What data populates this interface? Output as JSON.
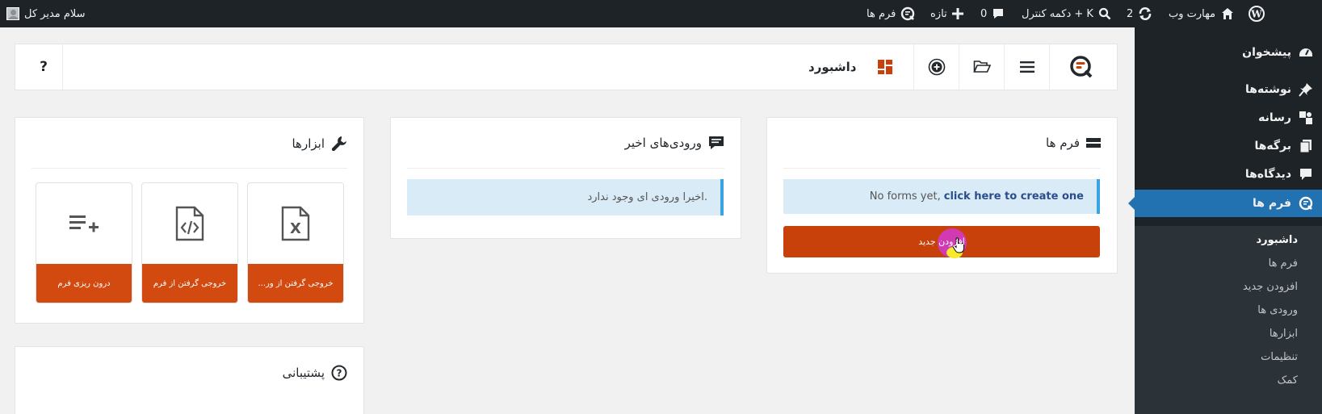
{
  "adminbar": {
    "site_name": "مهارت وب",
    "updates_count": "2",
    "search_label": "دکمه کنترل + K",
    "comments_count": "0",
    "new_label": "تازه",
    "forms_label": "فرم ها",
    "greeting": "سلام مدیر کل"
  },
  "menu": {
    "items": [
      {
        "label": "پیشخوان",
        "icon": "dashboard-icon"
      },
      {
        "label": "نوشته‌ها",
        "icon": "pin-icon"
      },
      {
        "label": "رسانه",
        "icon": "media-icon"
      },
      {
        "label": "برگه‌ها",
        "icon": "pages-icon"
      },
      {
        "label": "دیدگاه‌ها",
        "icon": "comment-icon"
      },
      {
        "label": "فرم ها",
        "icon": "forms-icon"
      }
    ],
    "submenu": [
      "داشبورد",
      "فرم ها",
      "افزودن جدید",
      "ورودی ها",
      "ابزارها",
      "تنظیمات",
      "کمک"
    ]
  },
  "toolbar": {
    "title": "داشبورد",
    "help_label": "?"
  },
  "forms_card": {
    "title": "فرم ها",
    "notice_text": "No forms yet, ",
    "notice_link": "click here to create one",
    "button_label": "افزودن جدید"
  },
  "entries_card": {
    "title": "ورودی‌های اخیر",
    "notice_text": "اخیرا ورودی ای وجود ندارد."
  },
  "tools_card": {
    "title": "ابزارها",
    "tiles": [
      {
        "label": "خروجی گرفتن از ور...",
        "icon": "excel-file-icon"
      },
      {
        "label": "خروجی گرفتن از فرم",
        "icon": "code-file-icon"
      },
      {
        "label": "درون ریزی فرم",
        "icon": "list-add-icon"
      }
    ]
  },
  "support_card": {
    "title": "پشتیبانی"
  },
  "colors": {
    "admin_dark": "#1d2327",
    "accent_blue": "#2271b1",
    "brand_orange": "#c8400a",
    "notice_bg": "#d9ebf6"
  }
}
